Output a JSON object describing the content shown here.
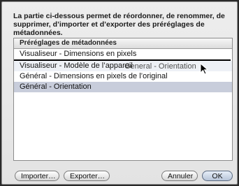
{
  "description": "La partie ci-dessous permet de réordonner, de renommer, de supprimer, d’importer et d’exporter des préréglages de métadonnées.",
  "list": {
    "header": "Préréglages de métadonnées",
    "rows": [
      "Visualiseur - Dimensions en pixels",
      "Visualiseur - Modèle de l’appareil",
      "Général - Dimensions en pixels de l’original",
      "Général - Orientation"
    ],
    "selected_index": 3,
    "drag_ghost": "General - Orientation"
  },
  "buttons": {
    "import": "Importer…",
    "export": "Exporter…",
    "cancel": "Annuler",
    "ok": "OK"
  },
  "colors": {
    "selection": "#c8cddb",
    "drop_indicator": "#000000"
  }
}
